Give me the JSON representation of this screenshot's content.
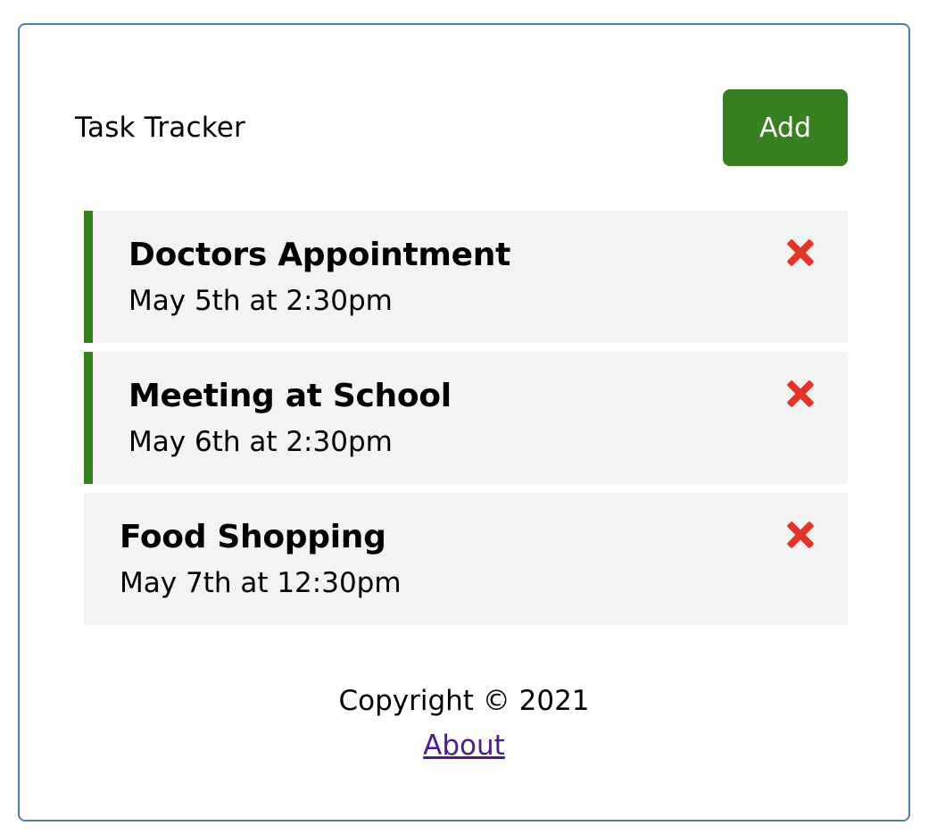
{
  "header": {
    "title": "Task Tracker",
    "add_label": "Add",
    "add_color": "#38801f"
  },
  "tasks": [
    {
      "text": "Doctors Appointment",
      "day": "May 5th at 2:30pm",
      "reminder": true
    },
    {
      "text": "Meeting at School",
      "day": "May 6th at 2:30pm",
      "reminder": true
    },
    {
      "text": "Food Shopping",
      "day": "May 7th at 12:30pm",
      "reminder": false
    }
  ],
  "delete_icon": "close-icon",
  "delete_color": "#e5332a",
  "footer": {
    "copyright": "Copyright © 2021",
    "about_label": "About"
  }
}
